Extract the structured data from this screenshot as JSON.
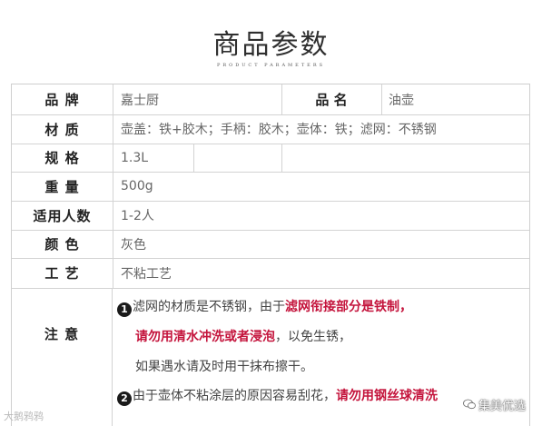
{
  "header": {
    "title": "商品参数",
    "subtitle": "PRODUCT PARAMETERS"
  },
  "params": {
    "brand_label": "品 牌",
    "brand_value": "嘉士厨",
    "name_label": "品 名",
    "name_value": "油壶",
    "material_label": "材 质",
    "material_value": "壶盖：铁+胶木；手柄：胶木；壶体：铁；滤网：不锈钢",
    "spec_label": "规 格",
    "spec_value": "1.3L",
    "weight_label": "重 量",
    "weight_value": "500g",
    "people_label": "适用人数",
    "people_value": "1-2人",
    "color_label": "颜 色",
    "color_value": "灰色",
    "craft_label": "工 艺",
    "craft_value": "不粘工艺",
    "notes_label": "注 意"
  },
  "notes": {
    "n1_num": "1",
    "n1_a": "滤网的材质是不锈钢，由于",
    "n1_b": "滤网衔接部分是铁制，",
    "n1_c": "请勿用清水冲洗或者浸泡",
    "n1_d": "，以免生锈，",
    "n1_e": "如果遇水请及时用干抹布擦干。",
    "n2_num": "2",
    "n2_a": "由于壶体不粘涂层的原因容易刮花，",
    "n2_b": "请勿用钢丝球清洗"
  },
  "watermarks": {
    "left": "大鹅鸦鸦",
    "right": "集美优选"
  },
  "colors": {
    "accent_red": "#c4143c",
    "border": "#d3d3d3"
  }
}
